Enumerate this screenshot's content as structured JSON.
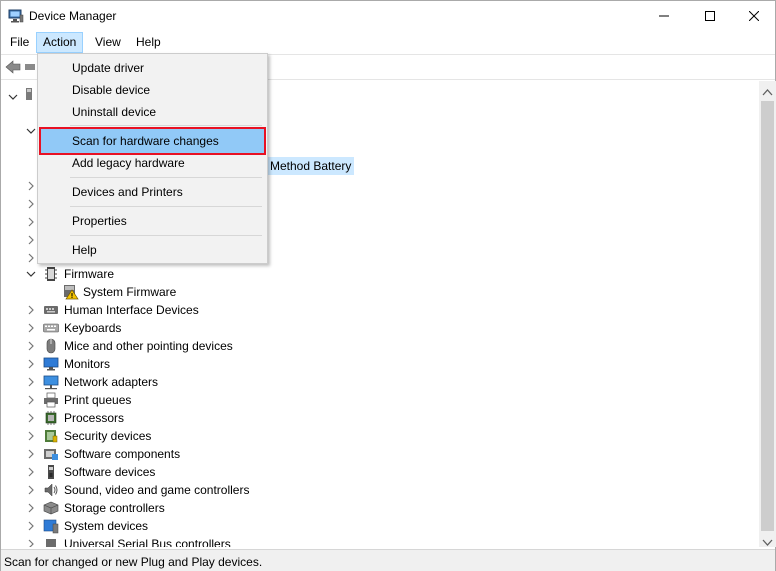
{
  "window": {
    "title": "Device Manager",
    "controls": {
      "minimize": "minimize-icon",
      "maximize": "maximize-icon",
      "close": "close-icon"
    }
  },
  "menubar": {
    "items": [
      {
        "label": "File"
      },
      {
        "label": "Action",
        "active": true
      },
      {
        "label": "View"
      },
      {
        "label": "Help"
      }
    ]
  },
  "action_menu": {
    "items": [
      {
        "label": "Update driver"
      },
      {
        "label": "Disable device"
      },
      {
        "label": "Uninstall device"
      },
      {
        "label": "Scan for hardware changes",
        "highlighted": true
      },
      {
        "label": "Add legacy hardware"
      },
      {
        "label": "Devices and Printers"
      },
      {
        "label": "Properties"
      },
      {
        "label": "Help"
      }
    ]
  },
  "tree": {
    "partial_highlight": "Method Battery",
    "items": [
      {
        "label": "Firmware",
        "expanded": true,
        "icon": "firmware-icon"
      },
      {
        "label": "System Firmware",
        "child": true,
        "icon": "warning-icon"
      },
      {
        "label": "Human Interface Devices",
        "icon": "hid-icon"
      },
      {
        "label": "Keyboards",
        "icon": "keyboard-icon"
      },
      {
        "label": "Mice and other pointing devices",
        "icon": "mouse-icon"
      },
      {
        "label": "Monitors",
        "icon": "monitor-icon"
      },
      {
        "label": "Network adapters",
        "icon": "network-icon"
      },
      {
        "label": "Print queues",
        "icon": "printer-icon"
      },
      {
        "label": "Processors",
        "icon": "processor-icon"
      },
      {
        "label": "Security devices",
        "icon": "security-icon"
      },
      {
        "label": "Software components",
        "icon": "software-component-icon"
      },
      {
        "label": "Software devices",
        "icon": "software-device-icon"
      },
      {
        "label": "Sound, video and game controllers",
        "icon": "sound-icon"
      },
      {
        "label": "Storage controllers",
        "icon": "storage-icon"
      },
      {
        "label": "System devices",
        "icon": "system-device-icon"
      },
      {
        "label": "Universal Serial Bus controllers",
        "icon": "usb-icon"
      }
    ]
  },
  "statusbar": {
    "text": "Scan for changed or new Plug and Play devices."
  },
  "colors": {
    "menu_active_bg": "#cce8ff",
    "menu_highlight_bg": "#91c9f7",
    "selection_outline": "#e81123",
    "tree_highlight_bg": "#cce8ff"
  }
}
